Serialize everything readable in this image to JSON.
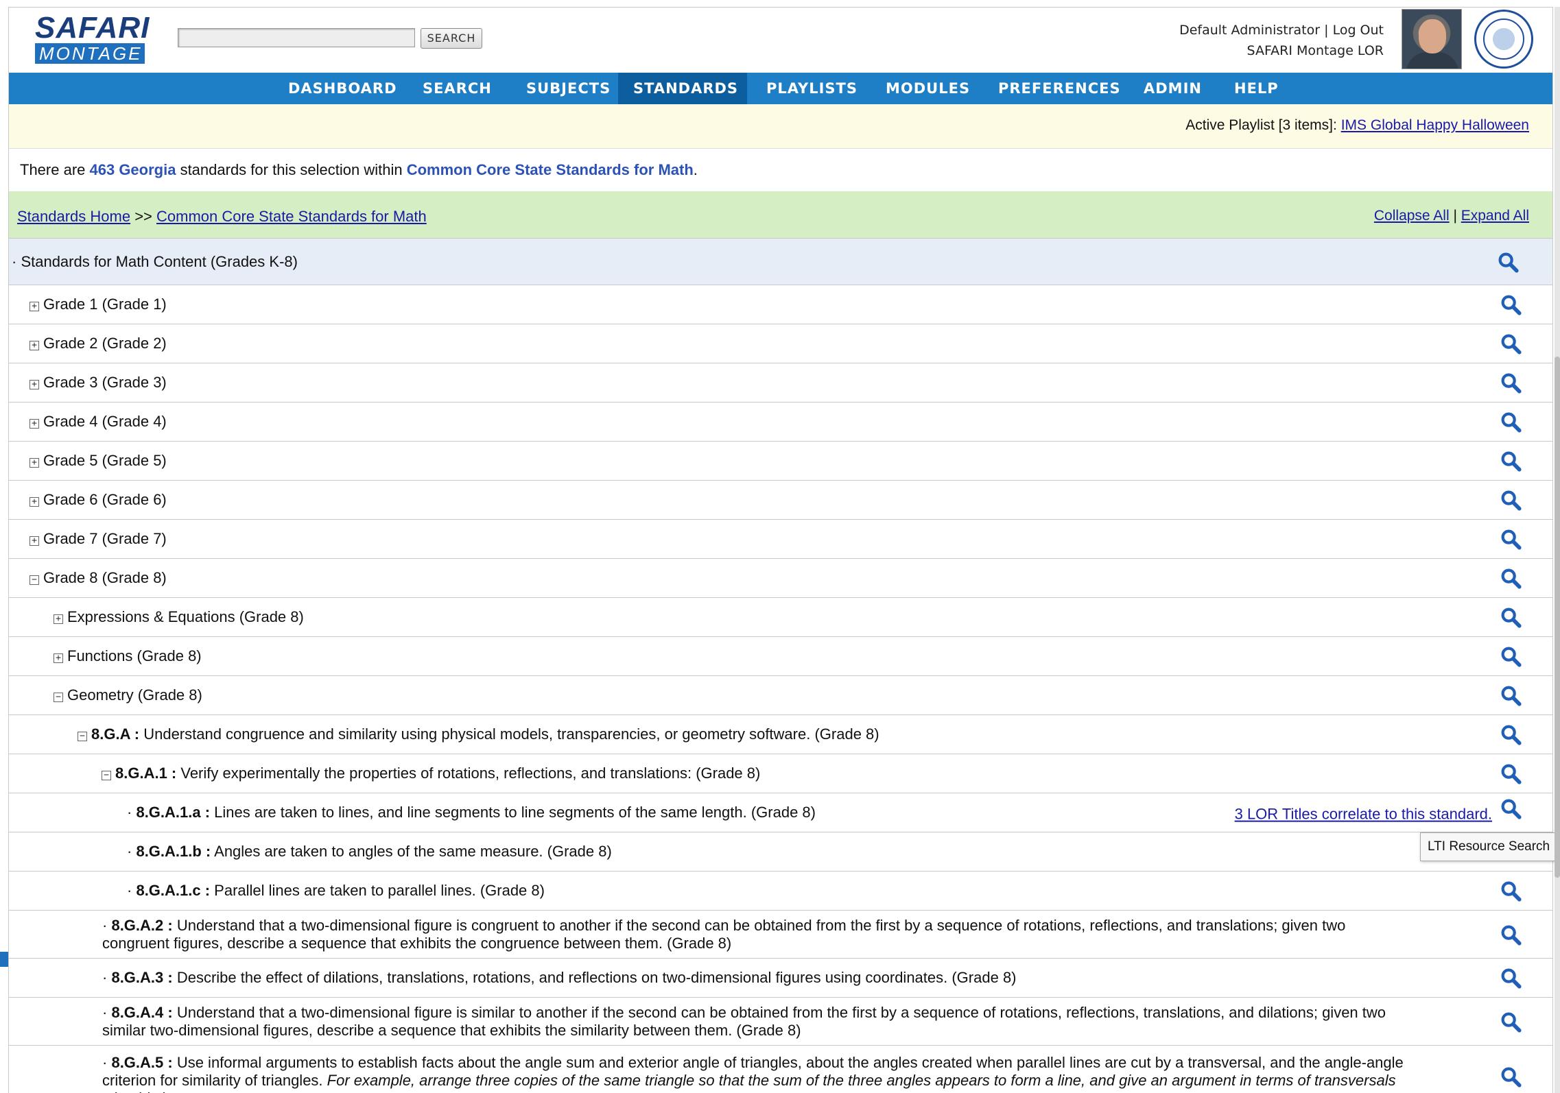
{
  "header": {
    "logo_top": "SAFARI",
    "logo_bottom": "MONTAGE",
    "search_button": "SEARCH",
    "user_name": "Default Administrator",
    "separator": "|",
    "logout": "Log Out",
    "site_name": "SAFARI Montage LOR"
  },
  "nav": [
    {
      "label": "DASHBOARD",
      "active": false
    },
    {
      "label": "SEARCH",
      "active": false
    },
    {
      "label": "SUBJECTS",
      "active": false
    },
    {
      "label": "STANDARDS",
      "active": true
    },
    {
      "label": "PLAYLISTS",
      "active": false
    },
    {
      "label": "MODULES",
      "active": false
    },
    {
      "label": "PREFERENCES",
      "active": false
    },
    {
      "label": "ADMIN",
      "active": false
    },
    {
      "label": "HELP",
      "active": false
    }
  ],
  "playlist": {
    "prefix": "Active Playlist [3 items]: ",
    "link": "IMS Global Happy Halloween"
  },
  "summary": {
    "p1": "There are ",
    "count": "463 Georgia",
    "p2": " standards for this selection within ",
    "set": "Common Core State Standards for Math",
    "p3": "."
  },
  "breadcrumb": {
    "home": "Standards Home",
    "sep": " >> ",
    "current": "Common Core State Standards for Math",
    "collapse": "Collapse All",
    "bar": " | ",
    "expand": "Expand All"
  },
  "tree": {
    "root": "· Standards for Math Content (Grades K-8)",
    "grades": [
      "Grade 1 (Grade 1)",
      "Grade 2 (Grade 2)",
      "Grade 3 (Grade 3)",
      "Grade 4 (Grade 4)",
      "Grade 5 (Grade 5)",
      "Grade 6 (Grade 6)",
      "Grade 7 (Grade 7)",
      "Grade 8 (Grade 8)"
    ],
    "domains": [
      "Expressions & Equations (Grade 8)",
      "Functions (Grade 8)",
      "Geometry (Grade 8)"
    ],
    "ga_code": "8.G.A :",
    "ga_text": " Understand congruence and similarity using physical models, transparencies, or geometry software. (Grade 8)",
    "ga1_code": "8.G.A.1 :",
    "ga1_text": " Verify experimentally the properties of rotations, reflections, and translations: (Grade 8)",
    "ga1a_code": "8.G.A.1.a :",
    "ga1a_text": " Lines are taken to lines, and line segments to line segments of the same length. (Grade 8)",
    "ga1a_corr": "3 LOR Titles correlate to this standard.",
    "ga1b_code": "8.G.A.1.b :",
    "ga1b_text": " Angles are taken to angles of the same measure. (Grade 8)",
    "ga1c_code": "8.G.A.1.c :",
    "ga1c_text": " Parallel lines are taken to parallel lines. (Grade 8)",
    "ga2_code": "8.G.A.2 :",
    "ga2_text": " Understand that a two-dimensional figure is congruent to another if the second can be obtained from the first by a sequence of rotations, reflections, and translations; given two congruent figures, describe a sequence that exhibits the congruence between them. (Grade 8)",
    "ga3_code": "8.G.A.3 :",
    "ga3_text": " Describe the effect of dilations, translations, rotations, and reflections on two-dimensional figures using coordinates. (Grade 8)",
    "ga4_code": "8.G.A.4 :",
    "ga4_text": " Understand that a two-dimensional figure is similar to another if the second can be obtained from the first by a sequence of rotations, reflections, translations, and dilations; given two similar two-dimensional figures, describe a sequence that exhibits the similarity between them. (Grade 8)",
    "ga5_code": "8.G.A.5 :",
    "ga5_text": " Use informal arguments to establish facts about the angle sum and exterior angle of triangles, about the angles created when parallel lines are cut by a transversal, and the angle-angle criterion for similarity of triangles. ",
    "ga5_example": "For example, arrange three copies of the same triangle so that the sum of the three angles appears to form a line, and give an argument in terms of transversals why this is so."
  },
  "tooltip": "LTI Resource Search",
  "icons": {
    "search": "magnifier-icon",
    "expand": "plus-box-icon",
    "collapse": "minus-box-icon"
  },
  "colors": {
    "nav": "#1f7fc6",
    "nav_active": "#0d5e9e",
    "crumb_bg": "#d6eec4",
    "link": "#1a1aa8",
    "accent_text": "#2b52b5"
  }
}
